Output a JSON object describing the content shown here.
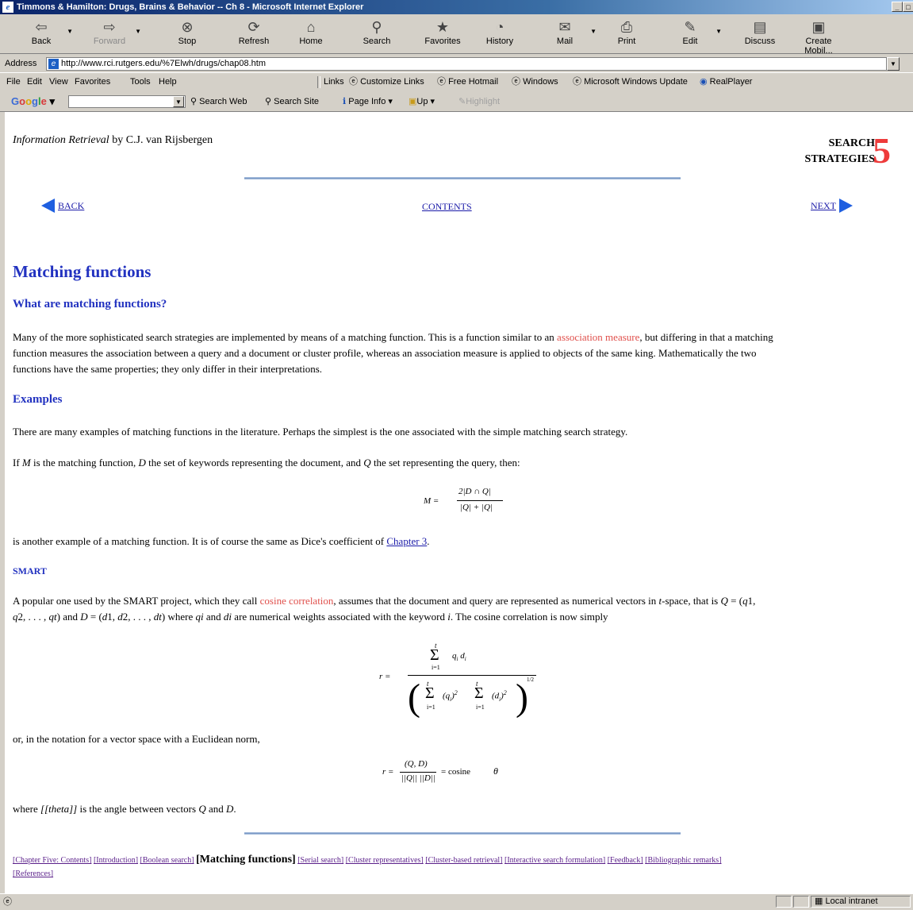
{
  "window": {
    "title": "Timmons & Hamilton: Drugs, Brains & Behavior -- Ch 8 - Microsoft Internet Explorer"
  },
  "toolbar": {
    "buttons": [
      {
        "label": "Back",
        "icon": "back-arrow-icon"
      },
      {
        "label": "Forward",
        "icon": "forward-arrow-icon"
      },
      {
        "label": "Stop",
        "icon": "stop-icon"
      },
      {
        "label": "Refresh",
        "icon": "refresh-icon"
      },
      {
        "label": "Home",
        "icon": "home-icon"
      },
      {
        "label": "Search",
        "icon": "search-icon"
      },
      {
        "label": "Favorites",
        "icon": "favorites-icon"
      },
      {
        "label": "History",
        "icon": "history-icon"
      },
      {
        "label": "Mail",
        "icon": "mail-icon"
      },
      {
        "label": "Print",
        "icon": "print-icon"
      },
      {
        "label": "Edit",
        "icon": "edit-icon"
      },
      {
        "label": "Discuss",
        "icon": "discuss-icon"
      },
      {
        "label": "Create Mobil...",
        "icon": "create-mobile-icon"
      }
    ]
  },
  "address": {
    "label": "Address",
    "url": "http://www.rci.rutgers.edu/%7Elwh/drugs/chap08.htm"
  },
  "menu": {
    "items": [
      "File",
      "Edit",
      "View",
      "Favorites",
      "Tools",
      "Help"
    ]
  },
  "links_bar": {
    "label": "Links",
    "items": [
      "Customize Links",
      "Free Hotmail",
      "Windows",
      "Microsoft Windows Update",
      "RealPlayer"
    ]
  },
  "google_bar": {
    "logo": "Google",
    "search_web": "Search Web",
    "search_site": "Search Site",
    "page_info": "Page Info",
    "up": "Up",
    "highlight": "Highlight"
  },
  "page": {
    "book_title": "Information Retrieval",
    "book_author": "by C.J. van Rijsbergen",
    "chapter_label_1": "SEARCH",
    "chapter_label_2": "STRATEGIES",
    "chapter_number": "5",
    "nav": {
      "back": "BACK",
      "contents": "CONTENTS",
      "next": "NEXT"
    },
    "heading": "Matching functions",
    "section1_title": "What are matching functions?",
    "section1_p": {
      "a": "Many of the more sophisticated search strategies are implemented by means of a matching function. This is a function similar to an ",
      "red": "association measure",
      "b": ", but differing in that a matching",
      "line2": "function measures the association between a query and a document or cluster profile, whereas an association measure is applied to objects of the same king. Mathematically the two",
      "line3": "functions have the same properties; they only differ in their interpretations."
    },
    "section2_title": "Examples",
    "ex_p1": "There are many examples of matching functions in the literature. Perhaps the simplest is the one associated with the simple matching search strategy.",
    "ex_p2": {
      "a": "If ",
      "M": "M",
      "b": " is the matching function, ",
      "D": "D",
      "c": " the set of keywords representing the document, and ",
      "Q": "Q",
      "d": " the set representing the query, then:"
    },
    "dice_p": {
      "a": "is another example of a matching function. It is of course the same as Dice's coefficient of ",
      "link": "Chapter 3",
      "b": "."
    },
    "smart_title": "SMART",
    "smart_p": {
      "a": "A popular one used by the SMART project, which they call ",
      "red": "cosine correlation",
      "b": ", assumes that the document and query are represented as numerical vectors in ",
      "t": "t",
      "c": "-space, that is ",
      "Qeq": "Q",
      "d": " = (",
      "q1": "q",
      "e": "1,",
      "line2a": "q",
      "line2b": "2, . . . , ",
      "line2c": "qt",
      "line2d": ") and ",
      "line2e": "D",
      "line2f": " = (",
      "line2g": "d",
      "line2h": "1, ",
      "line2i": "d",
      "line2j": "2, . . . , ",
      "line2k": "dt",
      "line2l": ") where ",
      "line2m": "qi",
      "line2n": " and ",
      "line2o": "di",
      "line2p": " are numerical weights associated with the keyword ",
      "line2q": "i",
      "line2r": ". The cosine correlation is now simply"
    },
    "euclid_p": "or, in the notation for a vector space with a Euclidean norm,",
    "theta_p": {
      "a": "where ",
      "theta": "[[theta]]",
      "b": " is the angle between vectors ",
      "Q": "Q",
      "c": " and ",
      "D": "D",
      "d": "."
    },
    "footer_links": [
      "[Chapter Five: Contents]",
      "[Introduction]",
      "[Boolean search]",
      "[Matching functions]",
      "[Serial search]",
      "[Cluster representatives]",
      "[Cluster-based retrieval]",
      "[Interactive search formulation]",
      "[Feedback]",
      "[Bibliographic remarks]",
      "[References]"
    ]
  },
  "formulas": {
    "dice": {
      "lhs": "M =",
      "num": "2|D ∩ Q|",
      "den": "|Q| + |Q|"
    },
    "cosine": {
      "lhs": "r =",
      "sum_upper": "t",
      "sum_lower": "i=1",
      "num_term": "q",
      "num_term2": "d",
      "sub_i": "i",
      "exp2": "2",
      "half": "1/2"
    },
    "euclid": {
      "lhs": "r =",
      "num": "(Q, D)",
      "den": "||Q|| ||D||",
      "rhs": "= cosine",
      "theta": "θ"
    }
  },
  "status": {
    "zone": "Local intranet"
  }
}
